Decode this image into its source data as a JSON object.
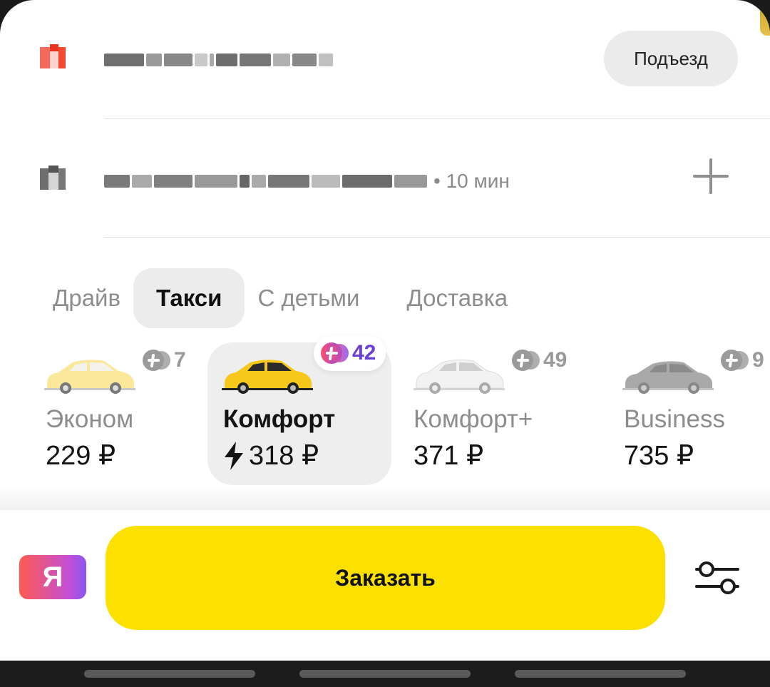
{
  "route": {
    "from": {
      "entrance_label": "Подъезд"
    },
    "to": {
      "eta": "• 10 мин"
    }
  },
  "tabs": [
    {
      "label": "Драйв",
      "active": false
    },
    {
      "label": "Такси",
      "active": true
    },
    {
      "label": "С детьми",
      "active": false
    },
    {
      "label": "Доставка",
      "active": false
    }
  ],
  "tariffs": [
    {
      "name": "Эконом",
      "price": "229 ₽",
      "plus_points": "7",
      "car_color": "light-yellow",
      "selected": false
    },
    {
      "name": "Комфорт",
      "price": "318 ₽",
      "plus_points": "42",
      "car_color": "yellow",
      "selected": true,
      "surge": true
    },
    {
      "name": "Комфорт+",
      "price": "371 ₽",
      "plus_points": "49",
      "car_color": "white",
      "selected": false
    },
    {
      "name": "Business",
      "price": "735 ₽",
      "plus_points": "9",
      "car_color": "gray",
      "selected": false
    }
  ],
  "bottom": {
    "logo_letter": "Я",
    "order_label": "Заказать",
    "settings_icon": "sliders-icon"
  },
  "colors": {
    "accent_yellow": "#fce000",
    "plus_purple": "#6b3fd4",
    "pin_red": "#f24a33"
  }
}
